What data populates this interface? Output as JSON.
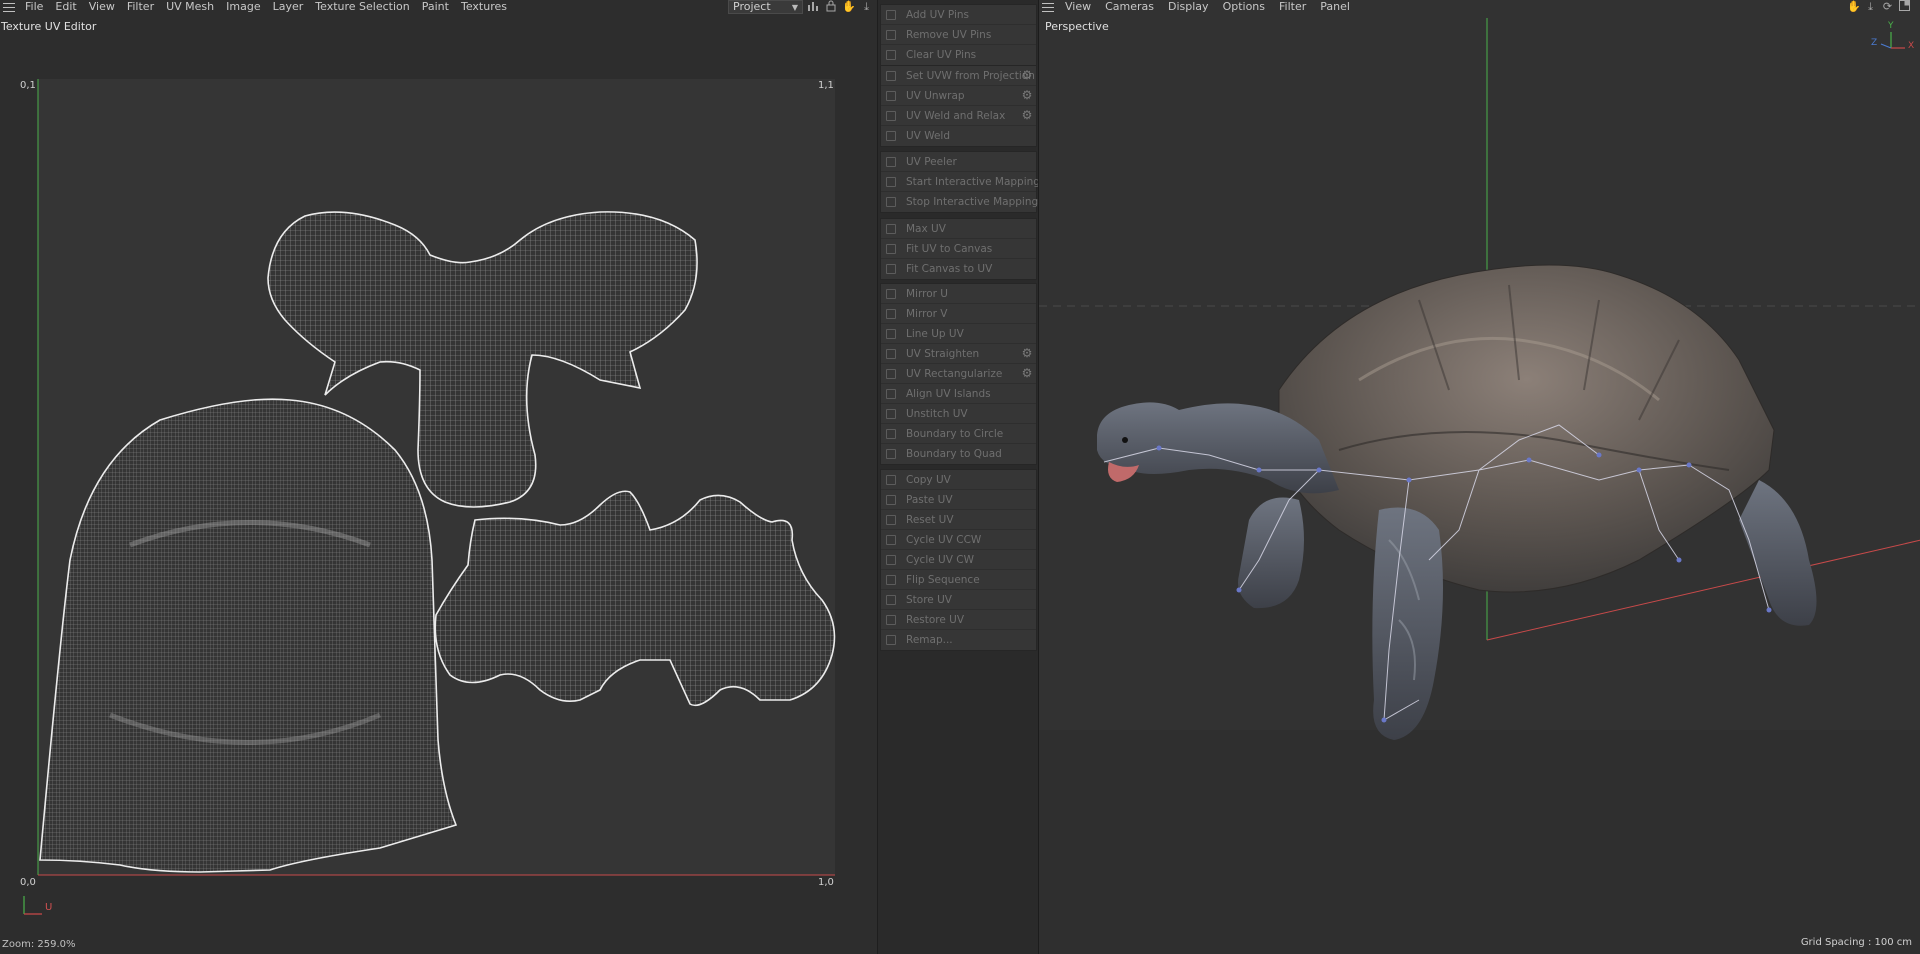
{
  "uv_editor": {
    "menu": [
      "File",
      "Edit",
      "View",
      "Filter",
      "UV Mesh",
      "Image",
      "Layer",
      "Texture Selection",
      "Paint",
      "Textures"
    ],
    "title": "Texture UV Editor",
    "project_select": "Project",
    "corners": {
      "top_left": "0,1",
      "top_right": "1,1",
      "bottom_left": "0,0",
      "bottom_right": "1,0"
    },
    "axis_u": "U",
    "zoom": "Zoom: 259.0%",
    "toolbar_icons": [
      "histogram-icon",
      "lock-icon",
      "hand-icon",
      "move-down-icon"
    ],
    "colors": {
      "u_axis": "#c84a4a",
      "v_axis": "#4ab04a",
      "uv_line": "#e8e8e8"
    }
  },
  "commands": {
    "groups": [
      [
        {
          "label": "Add UV Pins",
          "icon": "pin-add-icon"
        },
        {
          "label": "Remove UV Pins",
          "icon": "pin-remove-icon"
        },
        {
          "label": "Clear UV Pins",
          "icon": "clear-icon"
        }
      ],
      [
        {
          "label": "Set UVW from Projection",
          "icon": "projection-icon",
          "gear": true
        },
        {
          "label": "UV Unwrap",
          "icon": "unwrap-icon",
          "gear": true
        },
        {
          "label": "UV Weld and Relax",
          "icon": "weld-relax-icon",
          "gear": true
        },
        {
          "label": "UV Weld",
          "icon": "weld-icon"
        }
      ],
      [
        {
          "label": "UV Peeler",
          "icon": "peeler-icon"
        },
        {
          "label": "Start Interactive Mapping",
          "icon": "play-icon"
        },
        {
          "label": "Stop Interactive Mapping",
          "icon": "stop-icon"
        }
      ],
      [
        {
          "label": "Max UV",
          "icon": "max-icon"
        },
        {
          "label": "Fit UV to Canvas",
          "icon": "fit-uv-icon"
        },
        {
          "label": "Fit Canvas to UV",
          "icon": "fit-canvas-icon"
        }
      ],
      [
        {
          "label": "Mirror U",
          "icon": "mirror-u-icon"
        },
        {
          "label": "Mirror V",
          "icon": "mirror-v-icon"
        },
        {
          "label": "Line Up UV",
          "icon": "lineup-icon"
        },
        {
          "label": "UV Straighten",
          "icon": "straighten-icon",
          "gear": true
        },
        {
          "label": "UV Rectangularize",
          "icon": "rectangularize-icon",
          "gear": true
        },
        {
          "label": "Align UV Islands",
          "icon": "align-icon"
        },
        {
          "label": "Unstitch UV",
          "icon": "unstitch-icon"
        },
        {
          "label": "Boundary to Circle",
          "icon": "circle-icon"
        },
        {
          "label": "Boundary to Quad",
          "icon": "quad-icon"
        }
      ],
      [
        {
          "label": "Copy UV",
          "icon": "copy-icon"
        },
        {
          "label": "Paste UV",
          "icon": "paste-icon"
        },
        {
          "label": "Reset UV",
          "icon": "reset-icon"
        },
        {
          "label": "Cycle UV CCW",
          "icon": "ccw-icon"
        },
        {
          "label": "Cycle UV CW",
          "icon": "cw-icon"
        },
        {
          "label": "Flip Sequence",
          "icon": "flip-icon"
        },
        {
          "label": "Store UV",
          "icon": "store-icon"
        },
        {
          "label": "Restore UV",
          "icon": "restore-icon"
        },
        {
          "label": "Remap...",
          "icon": "remap-icon"
        }
      ]
    ]
  },
  "viewport": {
    "menu": [
      "View",
      "Cameras",
      "Display",
      "Options",
      "Filter",
      "Panel"
    ],
    "title": "Perspective",
    "grid_spacing": "Grid Spacing : 100 cm",
    "axis_labels": {
      "y": "Y",
      "z": "Z",
      "x": "X"
    },
    "toolbar_icons": [
      "hand-icon",
      "move-down-icon",
      "rotate-icon",
      "panel-icon"
    ],
    "colors": {
      "x_axis": "#c84a4a",
      "y_axis": "#4ab04a",
      "z_axis": "#4a7ad0"
    }
  }
}
